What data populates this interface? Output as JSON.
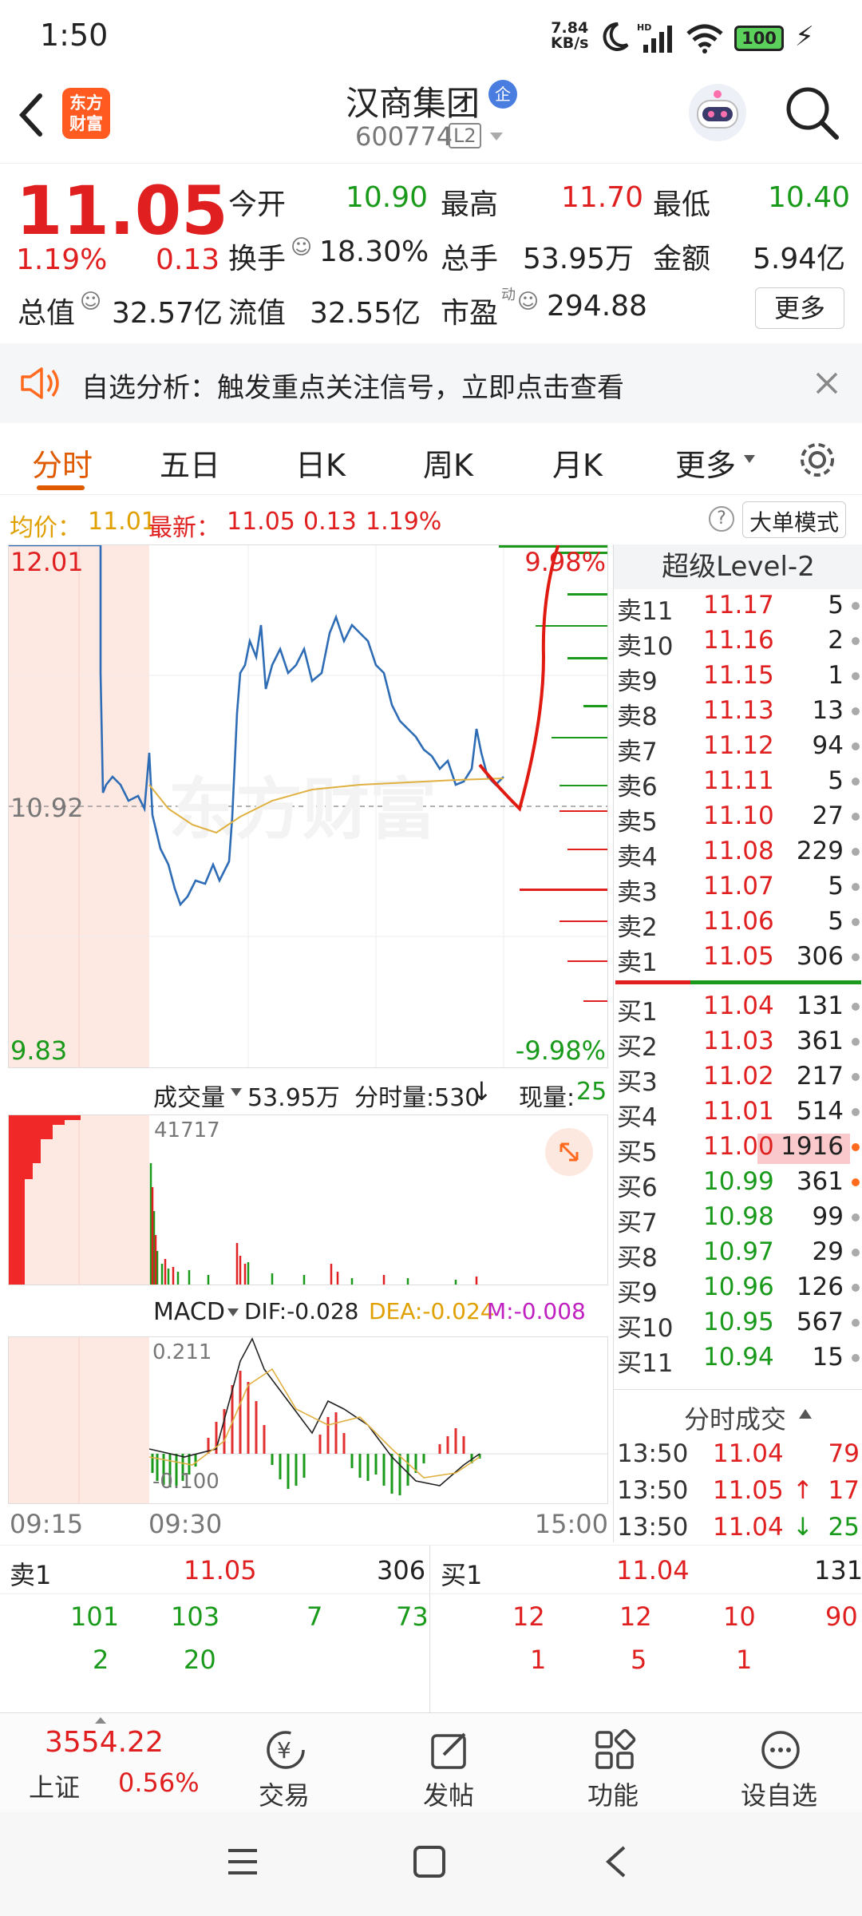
{
  "status": {
    "time": "1:50",
    "speed_top": "7.84",
    "speed_bottom": "KB/s",
    "battery": "100"
  },
  "header": {
    "logo_line1": "东方",
    "logo_line2": "财富",
    "title": "汉商集团",
    "badge": "企",
    "code": "600774",
    "level_tag": "L2"
  },
  "quote": {
    "price": "11.05",
    "change_pct": "1.19%",
    "change": "0.13",
    "open_label": "今开",
    "open": "10.90",
    "high_label": "最高",
    "high": "11.70",
    "low_label": "最低",
    "low": "10.40",
    "turnover_label": "换手",
    "turnover": "18.30%",
    "volume_label": "总手",
    "volume": "53.95万",
    "amount_label": "金额",
    "amount": "5.94亿",
    "mktcap_label": "总值",
    "mktcap": "32.57亿",
    "float_label": "流值",
    "float": "32.55亿",
    "pe_label": "市盈",
    "pe_sup": "动",
    "pe": "294.88",
    "more_button": "更多"
  },
  "banner": {
    "text": "自选分析：触发重点关注信号，立即点击查看"
  },
  "tabs": [
    "分时",
    "五日",
    "日K",
    "周K",
    "月K",
    "更多"
  ],
  "infobar": {
    "avg_label": "均价：",
    "avg": "11.01",
    "last_label": "最新：",
    "last": "11.05",
    "chg": "0.13",
    "pct": "1.19%",
    "mode_button": "大单模式"
  },
  "chart": {
    "y_top": "12.01",
    "y_mid": "10.92",
    "y_bottom": "9.83",
    "pct_top": "9.98%",
    "pct_bottom": "-9.98%",
    "watermark": "东方财富",
    "vol_label": "成交量",
    "vol_total": "53.95万",
    "vol_tick_label": "分时量:530",
    "vol_now_label": "现量:",
    "vol_now": "25",
    "vol_max": "41717",
    "macd_label": "MACD",
    "dif": "DIF:-0.028",
    "dea": "DEA:-0.024",
    "m": "M:-0.008",
    "macd_top": "0.211",
    "macd_bottom": "-0.100",
    "t_start": "09:15",
    "t_open": "09:30",
    "t_end": "15:00"
  },
  "orderbook": {
    "title": "超级Level-2",
    "asks": [
      {
        "label": "卖11",
        "price": "11.17",
        "qty": "5"
      },
      {
        "label": "卖10",
        "price": "11.16",
        "qty": "2"
      },
      {
        "label": "卖9",
        "price": "11.15",
        "qty": "1"
      },
      {
        "label": "卖8",
        "price": "11.13",
        "qty": "13"
      },
      {
        "label": "卖7",
        "price": "11.12",
        "qty": "94"
      },
      {
        "label": "卖6",
        "price": "11.11",
        "qty": "5"
      },
      {
        "label": "卖5",
        "price": "11.10",
        "qty": "27"
      },
      {
        "label": "卖4",
        "price": "11.08",
        "qty": "229"
      },
      {
        "label": "卖3",
        "price": "11.07",
        "qty": "5"
      },
      {
        "label": "卖2",
        "price": "11.06",
        "qty": "5"
      },
      {
        "label": "卖1",
        "price": "11.05",
        "qty": "306"
      }
    ],
    "bids": [
      {
        "label": "买1",
        "price": "11.04",
        "qty": "131"
      },
      {
        "label": "买2",
        "price": "11.03",
        "qty": "361"
      },
      {
        "label": "买3",
        "price": "11.02",
        "qty": "217"
      },
      {
        "label": "买4",
        "price": "11.01",
        "qty": "514"
      },
      {
        "label": "买5",
        "price": "11.00",
        "qty": "1916"
      },
      {
        "label": "买6",
        "price": "10.99",
        "qty": "361"
      },
      {
        "label": "买7",
        "price": "10.98",
        "qty": "99"
      },
      {
        "label": "买8",
        "price": "10.97",
        "qty": "29"
      },
      {
        "label": "买9",
        "price": "10.96",
        "qty": "126"
      },
      {
        "label": "买10",
        "price": "10.95",
        "qty": "567"
      },
      {
        "label": "买11",
        "price": "10.94",
        "qty": "15"
      }
    ],
    "trades_title": "分时成交",
    "trades": [
      {
        "time": "13:50",
        "price": "11.04",
        "arrow": "",
        "qty": "79"
      },
      {
        "time": "13:50",
        "price": "11.05",
        "arrow": "↑",
        "qty": "17"
      },
      {
        "time": "13:50",
        "price": "11.04",
        "arrow": "↓",
        "qty": "25"
      }
    ]
  },
  "bottom_book": {
    "sell_label": "卖1",
    "sell_price": "11.05",
    "sell_qty": "306",
    "buy_label": "买1",
    "buy_price": "11.04",
    "buy_qty": "131",
    "sell_orders": [
      "101",
      "103",
      "7",
      "73",
      "2",
      "20"
    ],
    "buy_orders": [
      "12",
      "12",
      "10",
      "90",
      "1",
      "5",
      "1"
    ]
  },
  "bottom_nav": {
    "index_value": "3554.22",
    "index_name": "上证",
    "index_pct": "0.56%",
    "trade": "交易",
    "post": "发帖",
    "func": "功能",
    "add": "设自选"
  },
  "colors": {
    "up": "#e02020",
    "down": "#1a9a1a",
    "brand": "#ff5a1f",
    "tab_active": "#e05a00"
  }
}
